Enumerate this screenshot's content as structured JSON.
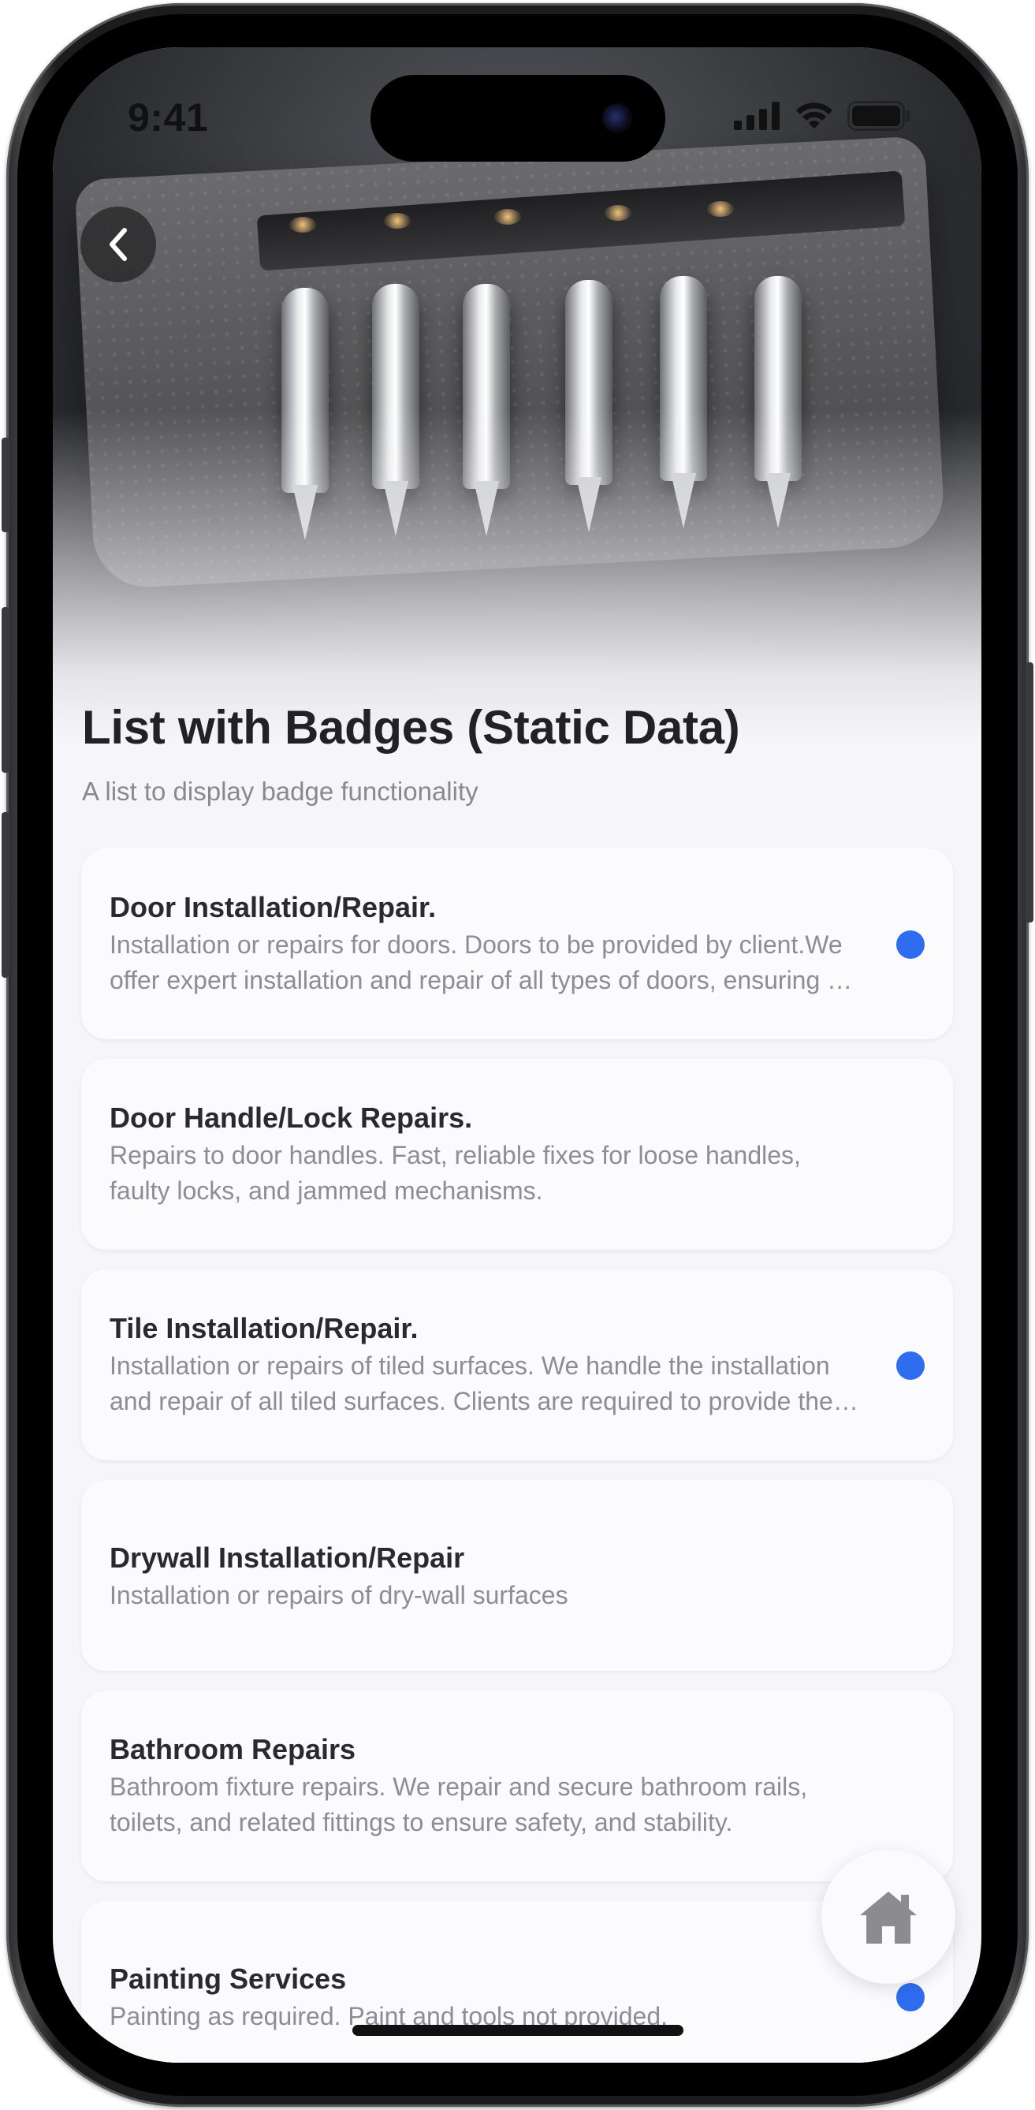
{
  "status_bar": {
    "time": "9:41",
    "icons": [
      "cellular-signal-icon",
      "wifi-icon",
      "battery-icon"
    ]
  },
  "hero": {
    "image": "screwdriver-bits-in-leather-pouch"
  },
  "header": {
    "back_icon": "chevron-left-icon",
    "title": "List with Badges (Static Data)",
    "subtitle": "A list to display badge functionality"
  },
  "list": {
    "items": [
      {
        "title": "Door Installation/Repair.",
        "description": "Installation or repairs for doors. Doors to be provided by client.We offer expert installation and repair of all types of doors, ensuring a secure and perfect fit.",
        "badge": true
      },
      {
        "title": "Door Handle/Lock Repairs.",
        "description": "Repairs to door handles. Fast, reliable fixes for loose handles, faulty locks, and jammed mechanisms.",
        "badge": false
      },
      {
        "title": "Tile Installation/Repair.",
        "description": "Installation or repairs of tiled surfaces.  We handle the installation and repair of all tiled surfaces. Clients are required to provide the tiles.",
        "badge": true
      },
      {
        "title": "Drywall Installation/Repair",
        "description": "Installation or repairs of dry-wall surfaces",
        "badge": false
      },
      {
        "title": "Bathroom Repairs",
        "description": "Bathroom fixture repairs. We repair and secure bathroom rails, toilets, and related fittings to ensure safety, and stability.",
        "badge": false
      },
      {
        "title": "Painting Services",
        "description": "Painting as required. Paint and tools not provided.",
        "badge": true
      }
    ]
  },
  "fab": {
    "icon": "home-icon"
  },
  "colors": {
    "badge": "#2f6df0",
    "background": "#f6f5f9",
    "card": "#fbfafc",
    "title": "#222226",
    "muted": "#8a8a8e"
  }
}
